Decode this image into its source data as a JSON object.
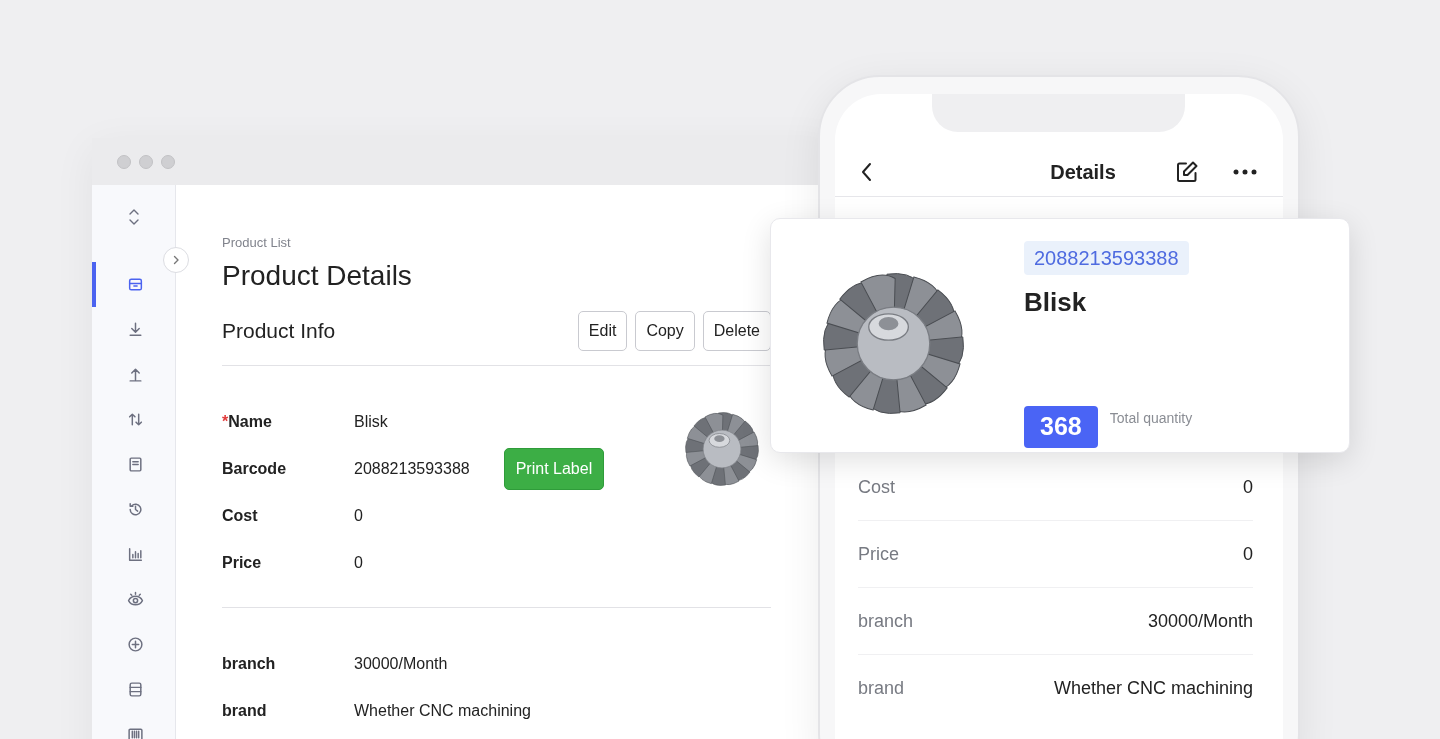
{
  "desktop_window": {
    "sidebar": {
      "items": [
        {
          "selected": true
        },
        {
          "selected": false
        },
        {
          "selected": false
        },
        {
          "selected": false
        },
        {
          "selected": false
        },
        {
          "selected": false
        },
        {
          "selected": false
        },
        {
          "selected": false
        },
        {
          "selected": false
        },
        {
          "selected": false
        },
        {
          "selected": false
        }
      ]
    },
    "breadcrumb": "Product List",
    "title": "Product Details",
    "section_title": "Product Info",
    "actions": [
      "Edit",
      "Copy",
      "Delete"
    ],
    "sections": [
      {
        "fields": [
          {
            "marker": "*",
            "label": "Name",
            "value": "Blisk"
          },
          {
            "label": "Barcode",
            "value": "2088213593388",
            "action": "Print Label"
          },
          {
            "label": "Cost",
            "value": "0"
          },
          {
            "label": "Price",
            "value": "0"
          }
        ]
      },
      {
        "fields": [
          {
            "label": "branch",
            "value": "30000/Month"
          },
          {
            "label": "brand",
            "value": "Whether CNC machining"
          }
        ]
      }
    ]
  },
  "phone": {
    "title": "Details",
    "card": {
      "barcode": "2088213593388",
      "name": "Blisk",
      "quantity": "368",
      "quantity_label": "Total quantity"
    },
    "rows": [
      {
        "label": "Cost",
        "value": "0"
      },
      {
        "label": "Price",
        "value": "0"
      },
      {
        "label": "branch",
        "value": "30000/Month"
      },
      {
        "label": "brand",
        "value": "Whether CNC machining"
      }
    ]
  }
}
